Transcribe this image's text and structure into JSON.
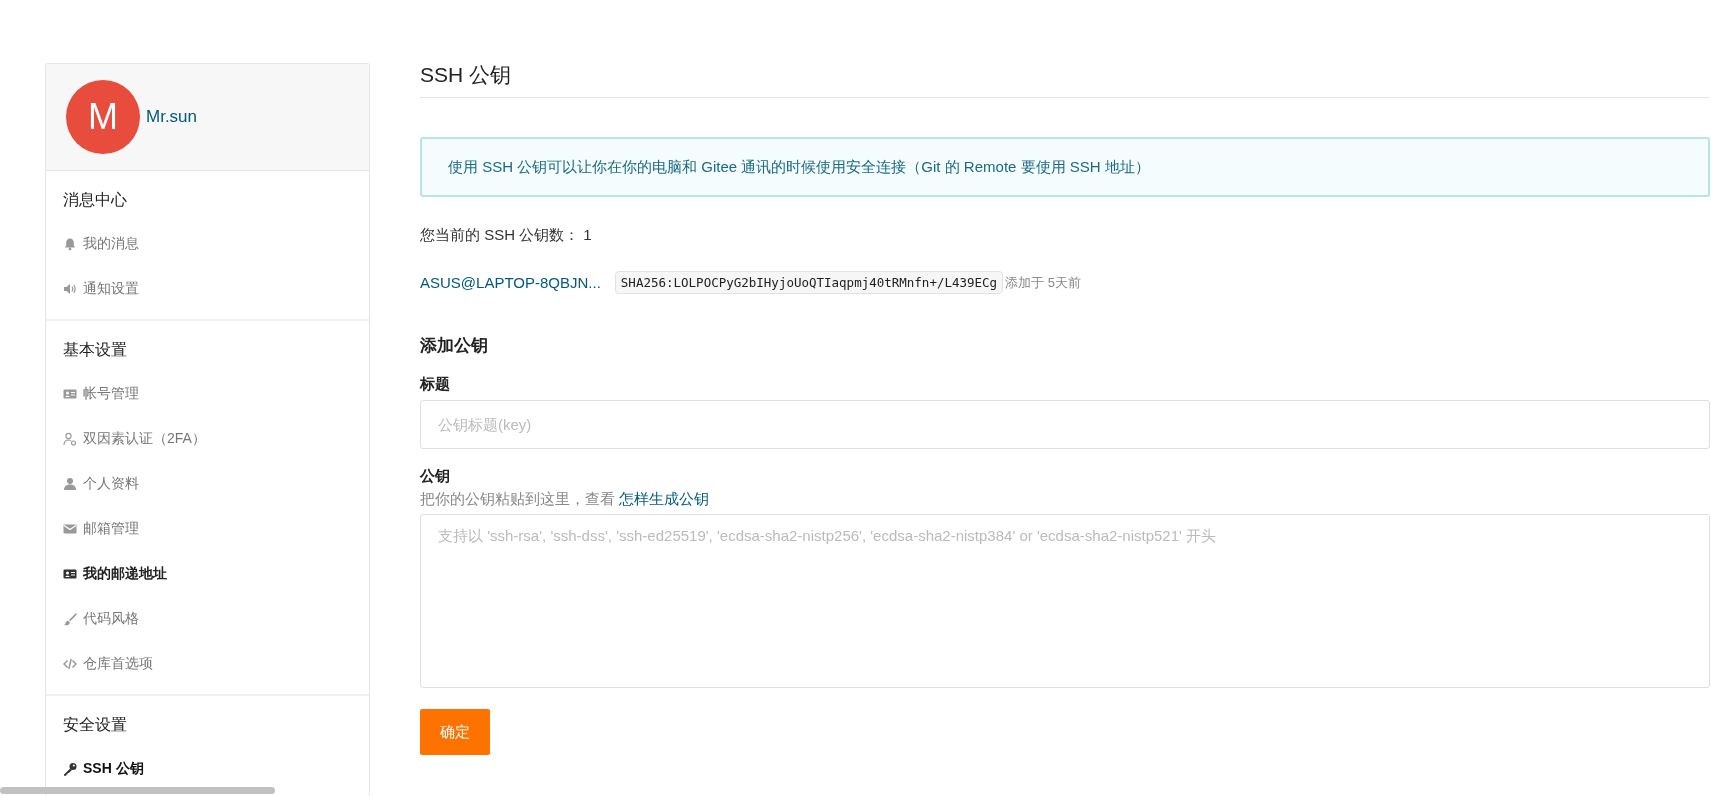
{
  "sidebar": {
    "user": {
      "avatar_letter": "M",
      "name": "Mr.sun"
    },
    "sections": [
      {
        "title": "消息中心",
        "items": [
          {
            "label": "我的消息",
            "kind": "messages",
            "selected": false,
            "bold": false
          },
          {
            "label": "通知设置",
            "kind": "notify",
            "selected": false,
            "bold": false
          }
        ]
      },
      {
        "title": "基本设置",
        "items": [
          {
            "label": "帐号管理",
            "kind": "account",
            "selected": false,
            "bold": false
          },
          {
            "label": "双因素认证（2FA）",
            "kind": "twofa",
            "selected": false,
            "bold": false
          },
          {
            "label": "个人资料",
            "kind": "profile",
            "selected": false,
            "bold": false
          },
          {
            "label": "邮箱管理",
            "kind": "email",
            "selected": false,
            "bold": false
          },
          {
            "label": "我的邮递地址",
            "kind": "address",
            "selected": false,
            "bold": true
          },
          {
            "label": "代码风格",
            "kind": "style",
            "selected": false,
            "bold": false
          },
          {
            "label": "仓库首选项",
            "kind": "repo",
            "selected": false,
            "bold": false
          }
        ]
      },
      {
        "title": "安全设置",
        "items": [
          {
            "label": "SSH 公钥",
            "kind": "ssh",
            "selected": true,
            "bold": true
          }
        ]
      }
    ]
  },
  "main": {
    "title": "SSH 公钥",
    "notice": "使用 SSH 公钥可以让你在你的电脑和 Gitee 通讯的时候使用安全连接（Git 的 Remote 要使用 SSH 地址）",
    "count_label": "您当前的 SSH 公钥数：",
    "count": "1",
    "keys": [
      {
        "title": "ASUS@LAPTOP-8QBJN...",
        "fingerprint": "SHA256:LOLPOCPyG2bIHyjoUoQTIaqpmj40tRMnfn+/L439ECg",
        "added": "添加于 5天前"
      }
    ],
    "form": {
      "heading": "添加公钥",
      "title_label": "标题",
      "title_placeholder": "公钥标题(key)",
      "key_label": "公钥",
      "key_hint": "把你的公钥粘贴到这里，查看",
      "key_hint_link": "怎样生成公钥",
      "key_placeholder": "支持以 'ssh-rsa', 'ssh-dss', 'ssh-ed25519', 'ecdsa-sha2-nistp256', 'ecdsa-sha2-nistp384' or 'ecdsa-sha2-nistp521' 开头",
      "submit": "确定"
    }
  }
}
